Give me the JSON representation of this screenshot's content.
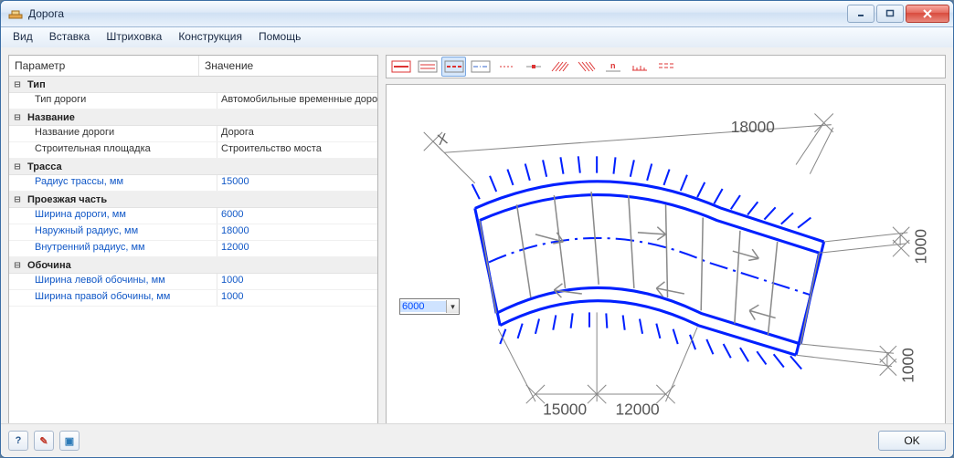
{
  "window": {
    "title": "Дорога"
  },
  "menubar": {
    "items": [
      "Вид",
      "Вставка",
      "Штриховка",
      "Конструкция",
      "Помощь"
    ]
  },
  "propgrid": {
    "headers": {
      "param": "Параметр",
      "value": "Значение"
    },
    "sections": [
      {
        "name": "Тип",
        "rows": [
          {
            "label": "Тип дороги",
            "value": "Автомобильные временные дороги",
            "link": false
          }
        ]
      },
      {
        "name": "Название",
        "rows": [
          {
            "label": "Название дороги",
            "value": "Дорога",
            "link": false
          },
          {
            "label": "Строительная площадка",
            "value": "Строительство моста",
            "link": false
          }
        ]
      },
      {
        "name": "Трасса",
        "rows": [
          {
            "label": "Радиус трассы, мм",
            "value": "15000",
            "link": true
          }
        ]
      },
      {
        "name": "Проезжая часть",
        "rows": [
          {
            "label": "Ширина дороги, мм",
            "value": "6000",
            "link": true
          },
          {
            "label": "Наружный радиус, мм",
            "value": "18000",
            "link": true
          },
          {
            "label": "Внутренний радиус, мм",
            "value": "12000",
            "link": true
          }
        ]
      },
      {
        "name": "Обочина",
        "rows": [
          {
            "label": "Ширина левой обочины, мм",
            "value": "1000",
            "link": true
          },
          {
            "label": "Ширина правой обочины, мм",
            "value": "1000",
            "link": true
          }
        ]
      }
    ]
  },
  "toolbar": {
    "buttons": [
      {
        "name": "pattern-solid-red",
        "active": false
      },
      {
        "name": "pattern-double-line",
        "active": false
      },
      {
        "name": "pattern-dash",
        "active": true
      },
      {
        "name": "pattern-dashdot",
        "active": false
      },
      {
        "name": "pattern-short-dash",
        "active": false
      },
      {
        "name": "pattern-center",
        "active": false
      },
      {
        "name": "pattern-hatch-1",
        "active": false
      },
      {
        "name": "pattern-hatch-2",
        "active": false
      },
      {
        "name": "pattern-label-n",
        "active": false
      },
      {
        "name": "pattern-ruler",
        "active": false
      },
      {
        "name": "pattern-rows",
        "active": false
      }
    ]
  },
  "preview": {
    "combo_value": "6000",
    "dims": {
      "outer_r": "18000",
      "trace_r": "15000",
      "inner_r": "12000",
      "shoulder_l": "1000",
      "shoulder_r": "1000"
    }
  },
  "buttons": {
    "ok": "OK"
  }
}
